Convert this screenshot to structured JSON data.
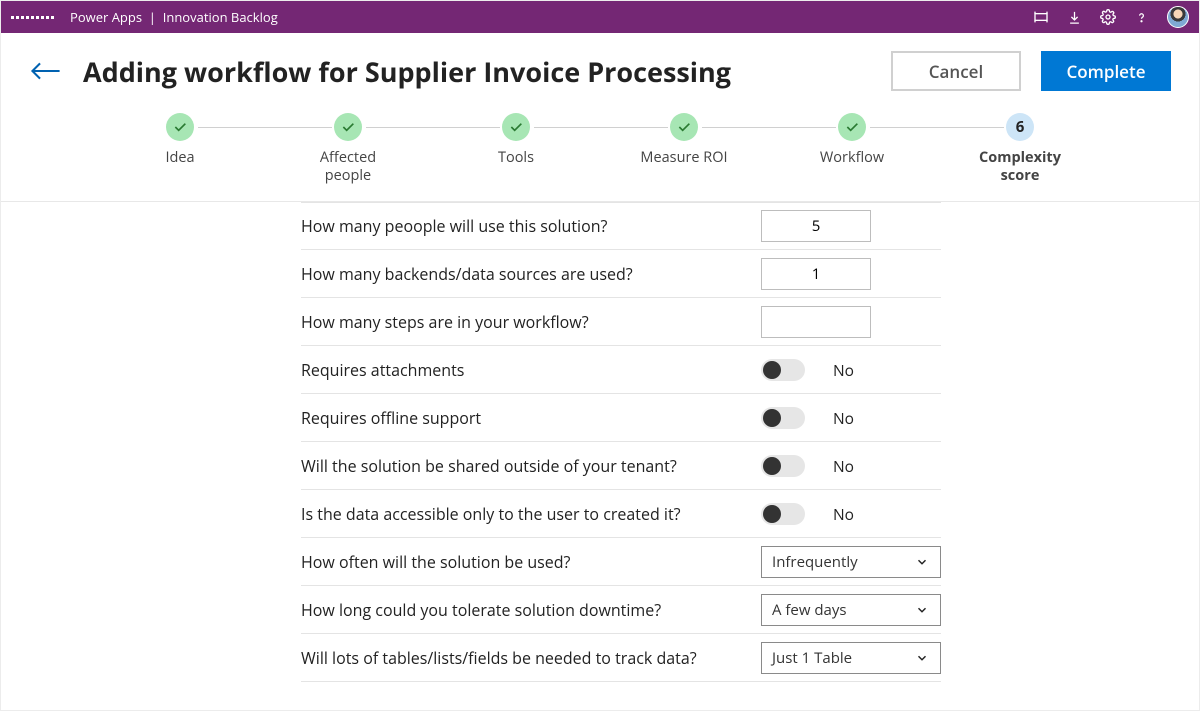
{
  "topbar": {
    "product": "Power Apps",
    "separator": "|",
    "app_name": "Innovation Backlog"
  },
  "header": {
    "title": "Adding workflow for Supplier Invoice Processing",
    "cancel_label": "Cancel",
    "complete_label": "Complete"
  },
  "steps": [
    {
      "label": "Idea",
      "done": true
    },
    {
      "label": "Affected people",
      "done": true
    },
    {
      "label": "Tools",
      "done": true
    },
    {
      "label": "Measure ROI",
      "done": true
    },
    {
      "label": "Workflow",
      "done": true
    },
    {
      "label": "Complexity score",
      "done": false,
      "current": true,
      "num": "6"
    }
  ],
  "form": {
    "q_people": {
      "label": "How many peoople will use this solution?",
      "value": "5"
    },
    "q_backends": {
      "label": "How many backends/data sources are  used?",
      "value": "1"
    },
    "q_steps": {
      "label": "How many steps are in your workflow?",
      "value": ""
    },
    "q_attach": {
      "label": "Requires attachments",
      "value": "No"
    },
    "q_offline": {
      "label": "Requires offline support",
      "value": "No"
    },
    "q_shared": {
      "label": "Will the solution be shared  outside of your tenant?",
      "value": "No"
    },
    "q_access": {
      "label": "Is the data accessible only to the user to created it?",
      "value": "No"
    },
    "q_freq": {
      "label": "How often will the solution be used?",
      "value": "Infrequently"
    },
    "q_downtime": {
      "label": "How long could you tolerate solution downtime?",
      "value": "A few days"
    },
    "q_tables": {
      "label": "Will lots of tables/lists/fields be needed to track data?",
      "value": "Just 1 Table"
    }
  }
}
